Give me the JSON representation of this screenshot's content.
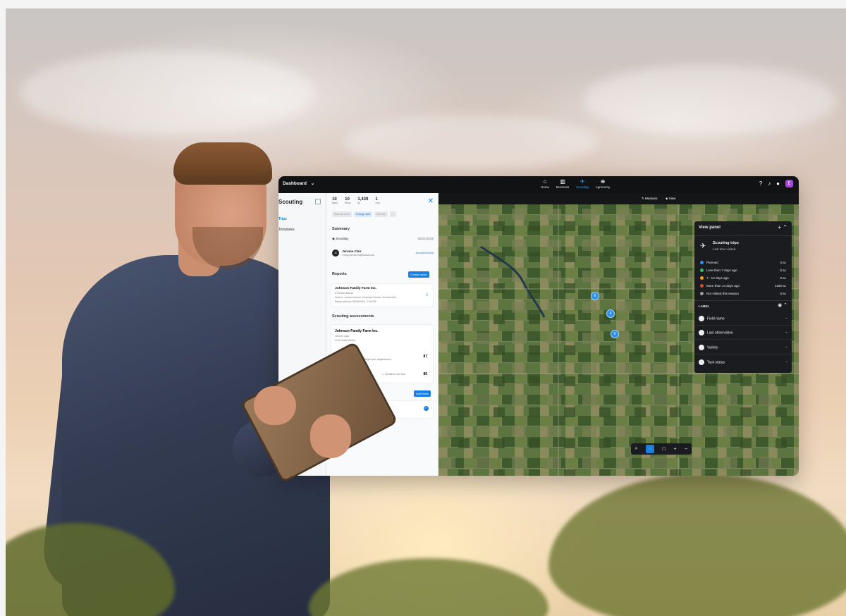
{
  "app": {
    "workspace": "Dashboard",
    "nav": [
      {
        "label": "Home",
        "icon": "home-icon",
        "glyph": "⌂"
      },
      {
        "label": "Business",
        "icon": "business-icon",
        "glyph": "▥"
      },
      {
        "label": "Scouting",
        "icon": "scouting-icon",
        "glyph": "✈",
        "active": true
      },
      {
        "label": "Agronomy",
        "icon": "agronomy-icon",
        "glyph": "⊕"
      }
    ],
    "avatar_initial": "E"
  },
  "sidebar": {
    "title": "Scouting",
    "items": [
      "Trips",
      "Templates"
    ]
  },
  "stats": [
    {
      "value": "10",
      "label": "tasks"
    },
    {
      "value": "10",
      "label": "fields"
    },
    {
      "value": "1,439",
      "label": "ac"
    },
    {
      "value": "1",
      "label": "crop"
    }
  ],
  "pills": [
    "Mark as done",
    "Change date",
    "Edit trip",
    "..."
  ],
  "summary": {
    "heading": "Summary",
    "trip_label": "Scouting",
    "trip_date": "06/21/2025",
    "person_name": "Jerome Clair",
    "person_email": "fl-klog.mrmerres@icloud.com",
    "person_initials": "JC",
    "accept_label": "Accept/Decline"
  },
  "reports": {
    "heading": "Reports",
    "create_label": "Create report",
    "farm": "Johnson Family Farm Inc.",
    "observations": "2 Observations",
    "sent_to": "Sent to: Johann Kasuch, Deborah Francis, Jerome Clair",
    "sent_on": "Report sent on: 06/30/2025 - 2:18 PM"
  },
  "assessments": {
    "heading": "Scouting assessments",
    "farm": "Johnson Family Farm Inc.",
    "person": "Jerome Clair",
    "fields_visited": "2/10 Fields visited",
    "crop": "Soybean",
    "crop_detail": "Septoria brown spot, Target spot, alligatorweed",
    "crop_score": "87",
    "second_detail": "...t, Northern corn leaf",
    "second_score": "85",
    "add_fields_label": "Add fields",
    "field_name": "...amily Farm",
    "field_detail": "...de B - 87.51 ac"
  },
  "map_toolbar": {
    "measure": "Measure",
    "view": "View"
  },
  "view_panel": {
    "title": "View panel",
    "trips_title": "Scouting trips",
    "trips_subtitle": "Last time visited",
    "legend": [
      {
        "label": "Planned",
        "value": "0 ac",
        "color": "#2f8fe6"
      },
      {
        "label": "Less than 7 days ago",
        "value": "0 ac",
        "color": "#2fbf71"
      },
      {
        "label": "7 - 14 days ago",
        "value": "0 ac",
        "color": "#f2a31b"
      },
      {
        "label": "More than 14 days ago",
        "value": "1158 ac",
        "color": "#e0482f"
      },
      {
        "label": "Not visited this season",
        "value": "0 ac",
        "color": "#9a9a9a"
      }
    ],
    "label_heading": "LABEL",
    "labels": [
      "Field name",
      "Last observation",
      "Variety",
      "Task status"
    ]
  },
  "map_markers": [
    "6",
    "6",
    "6"
  ]
}
